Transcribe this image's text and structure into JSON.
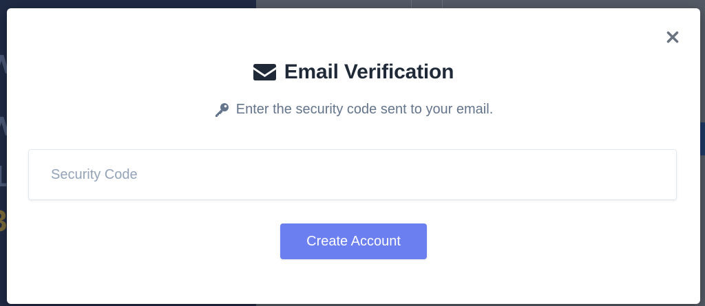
{
  "modal": {
    "title": "Email Verification",
    "title_icon": "envelope-icon",
    "subtitle": "Enter the security code sent to your email.",
    "subtitle_icon": "key-icon",
    "close_icon": "close-icon"
  },
  "form": {
    "code_input": {
      "value": "",
      "placeholder": "Security Code"
    },
    "submit_label": "Create Account"
  },
  "colors": {
    "primary_button": "#6b7ff0",
    "title_text": "#1f2937",
    "subtitle_text": "#64748b",
    "placeholder_text": "#94a3b8",
    "overlay": "#4b5563"
  }
}
